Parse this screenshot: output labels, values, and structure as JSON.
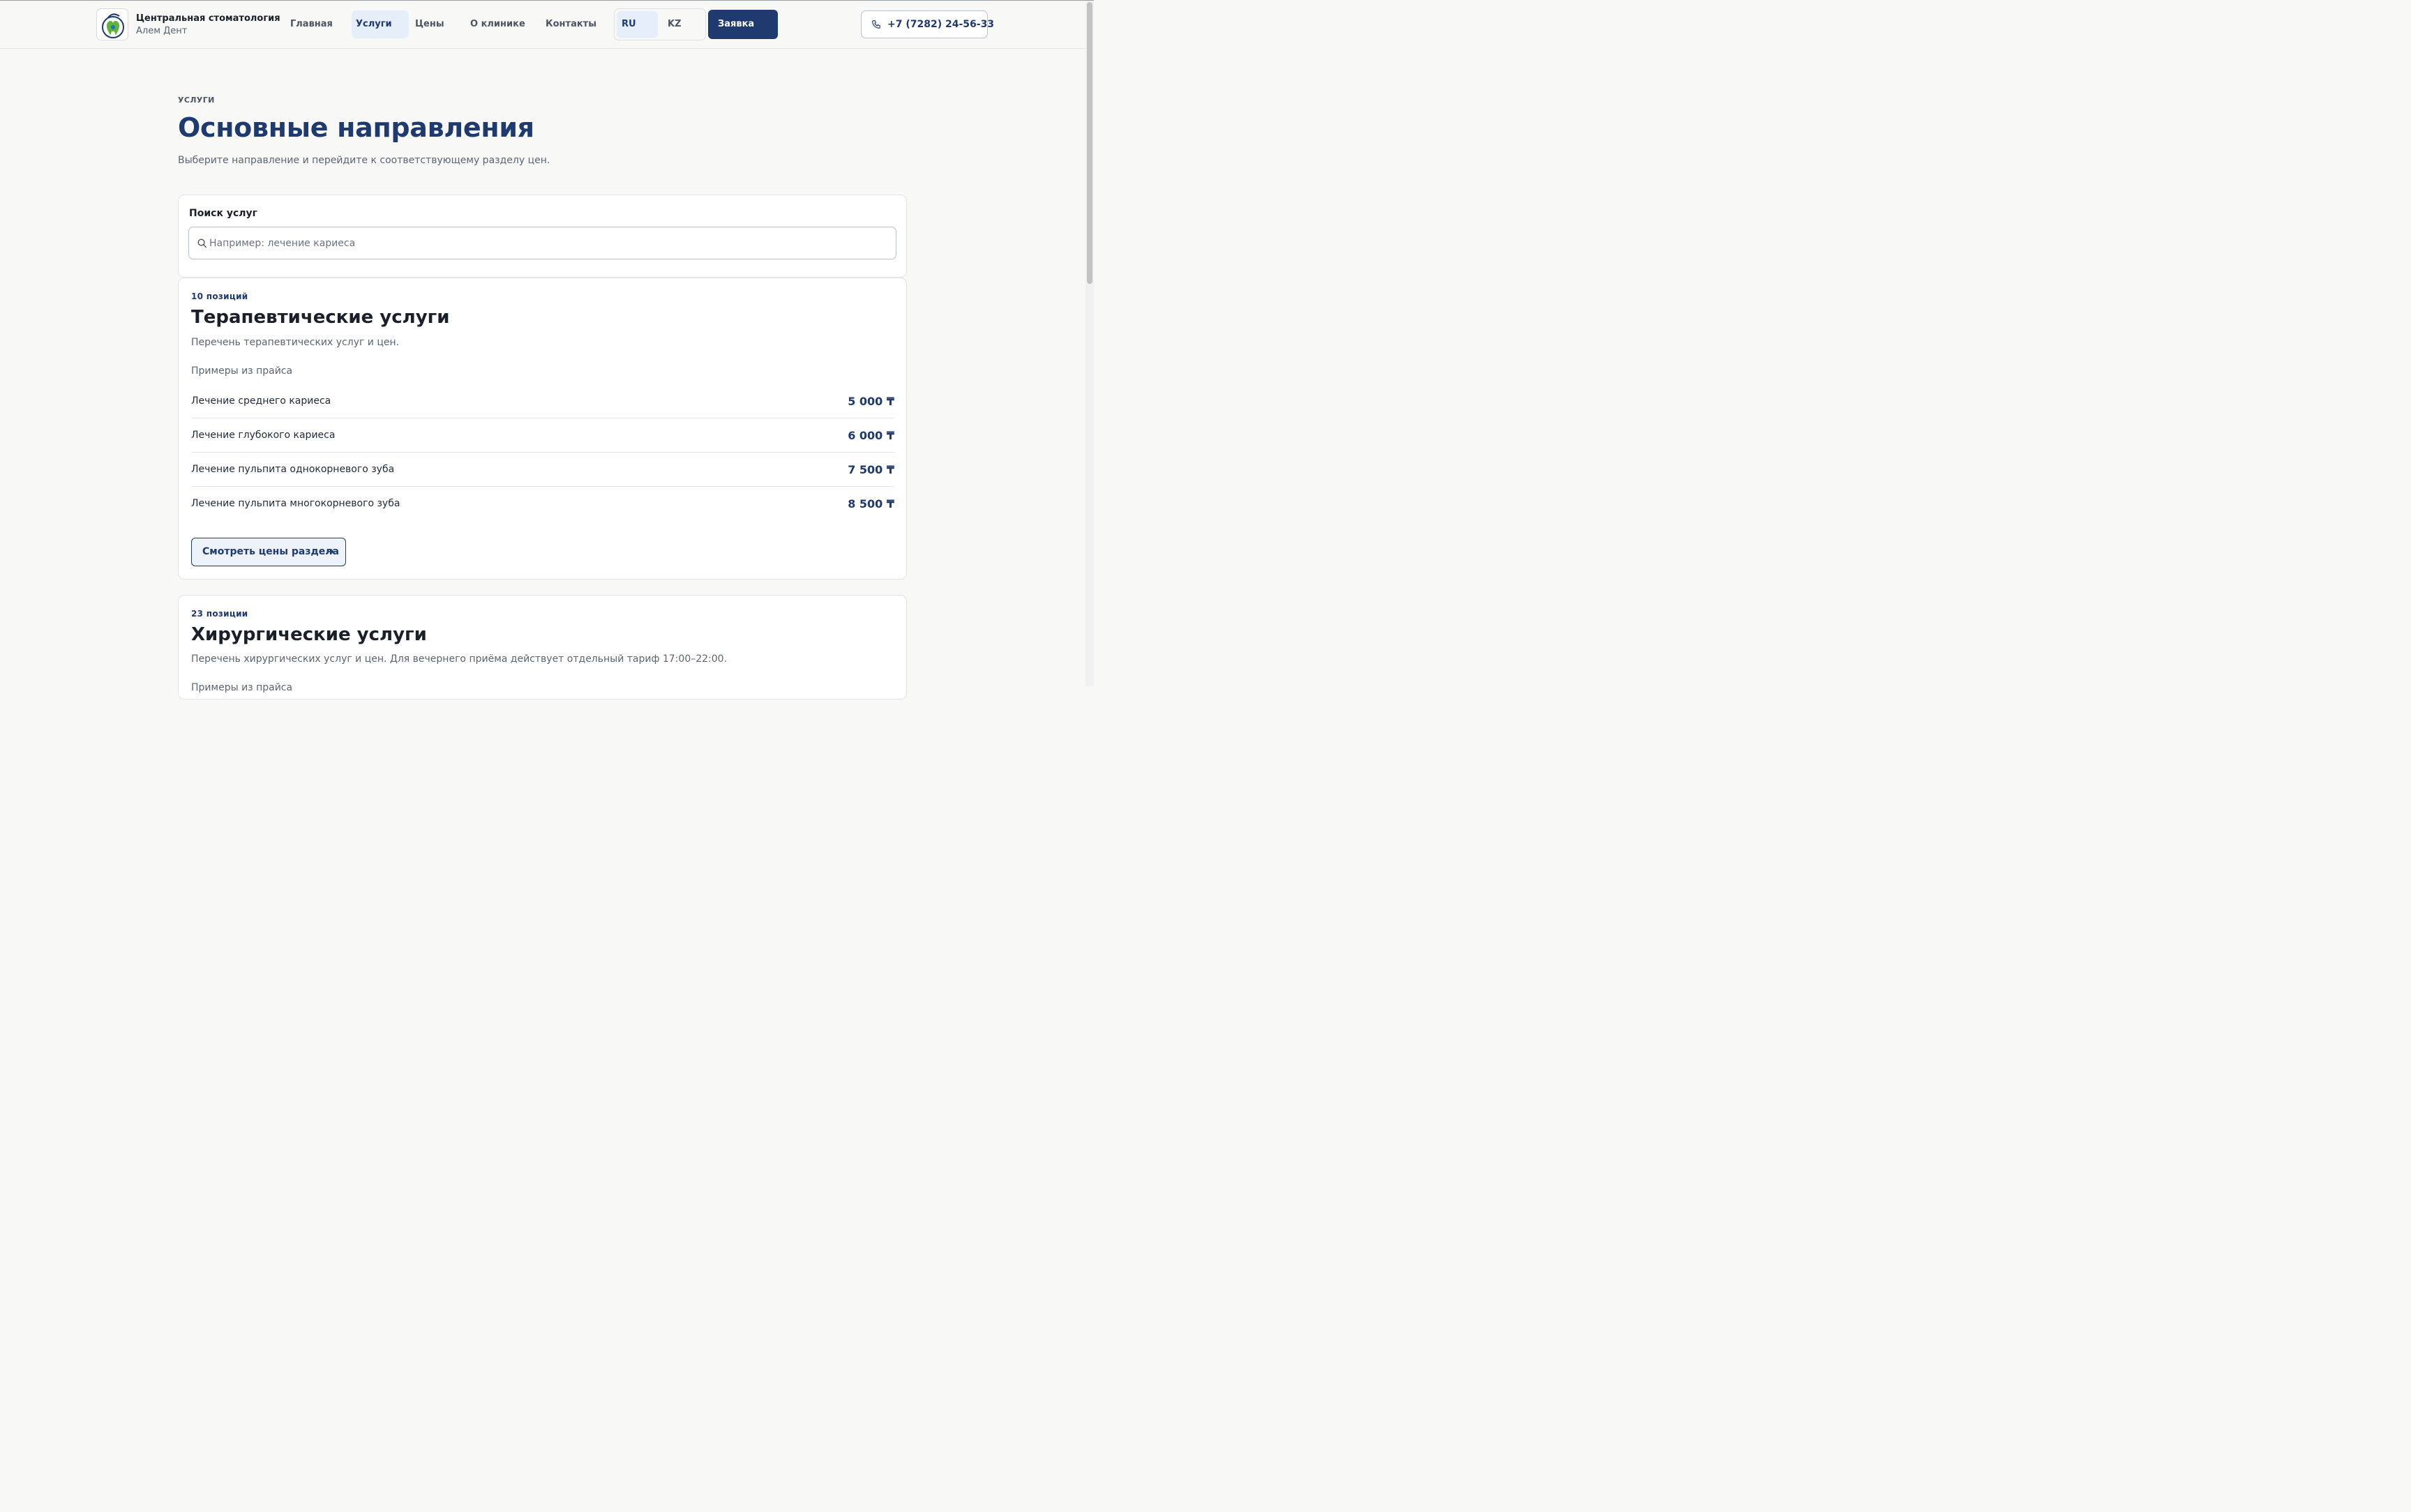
{
  "header": {
    "brand_title": "Центральная стоматология",
    "brand_subtitle": "Алем Дент",
    "logo_text": "АЛЕМ ДЕНТ",
    "nav": [
      {
        "label": "Главная",
        "active": false
      },
      {
        "label": "Услуги",
        "active": true
      },
      {
        "label": "Цены",
        "active": false
      },
      {
        "label": "О клинике",
        "active": false
      },
      {
        "label": "Контакты",
        "active": false
      }
    ],
    "languages": [
      {
        "label": "RU",
        "active": true
      },
      {
        "label": "KZ",
        "active": false
      }
    ],
    "order_button": "Заявка",
    "phone": "+7 (7282) 24-56-33"
  },
  "page": {
    "eyebrow": "УСЛУГИ",
    "title": "Основные направления",
    "subtitle": "Выберите направление и перейдите к соответствующему разделу цен."
  },
  "search": {
    "label": "Поиск услуг",
    "placeholder": "Например: лечение кариеса",
    "value": ""
  },
  "categories": [
    {
      "count": "10 позиций",
      "title": "Терапевтические услуги",
      "description": "Перечень терапевтических услуг и цен.",
      "examples_label": "Примеры из прайса",
      "items": [
        {
          "name": "Лечение среднего кариеса",
          "price": "5 000 ₸"
        },
        {
          "name": "Лечение глубокого кариеса",
          "price": "6 000 ₸"
        },
        {
          "name": "Лечение пульпита однокорневого зуба",
          "price": "7 500 ₸"
        },
        {
          "name": "Лечение пульпита многокорневого зуба",
          "price": "8 500 ₸"
        }
      ],
      "button": "Смотреть цены раздела",
      "button_arrow": "→"
    },
    {
      "count": "23 позиции",
      "title": "Хирургические услуги",
      "description": "Перечень хирургических услуг и цен. Для вечернего приёма действует отдельный тариф 17:00–22:00.",
      "examples_label": "Примеры из прайса"
    }
  ],
  "colors": {
    "accent": "#1e3a6e",
    "active_bg": "#e6eef9",
    "page_bg": "#f8f8f7"
  }
}
